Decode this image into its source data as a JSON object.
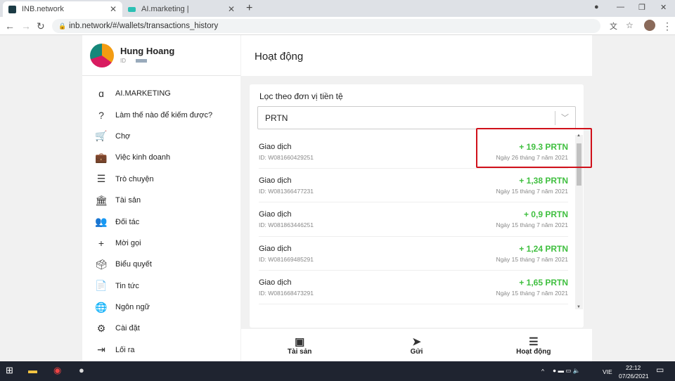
{
  "browser": {
    "tabs": [
      {
        "title": "INB.network"
      },
      {
        "title": "AI.marketing |"
      }
    ],
    "url": "inb.network/#/wallets/transactions_history"
  },
  "profile": {
    "name": "Hung Hoang",
    "id_label": "ID"
  },
  "menu": [
    {
      "label": "AI.MARKETING",
      "icon": "ai-logo-icon",
      "glyph": "ɑ"
    },
    {
      "label": "Làm thế nào để kiếm được?",
      "icon": "help-icon",
      "glyph": "?"
    },
    {
      "label": "Chợ",
      "icon": "cart-icon",
      "glyph": "🛒"
    },
    {
      "label": "Việc kinh doanh",
      "icon": "briefcase-icon",
      "glyph": "💼"
    },
    {
      "label": "Trò chuyện",
      "icon": "chat-icon",
      "glyph": "☰"
    },
    {
      "label": "Tài sản",
      "icon": "bank-icon",
      "glyph": "🏛"
    },
    {
      "label": "Đối tác",
      "icon": "partners-icon",
      "glyph": "👥"
    },
    {
      "label": "Mời gọi",
      "icon": "invite-icon",
      "glyph": "+"
    },
    {
      "label": "Biểu quyết",
      "icon": "vote-icon",
      "glyph": "🗳"
    },
    {
      "label": "Tin tức",
      "icon": "news-icon",
      "glyph": "📄"
    },
    {
      "label": "Ngôn ngữ",
      "icon": "globe-icon",
      "glyph": "🌐"
    },
    {
      "label": "Cài đặt",
      "icon": "gear-icon",
      "glyph": "⚙"
    },
    {
      "label": "Lối ra",
      "icon": "logout-icon",
      "glyph": "⇥"
    }
  ],
  "main": {
    "title": "Hoạt động",
    "filter_label": "Lọc theo đơn vị tiền tệ",
    "currency": "PRTN"
  },
  "transactions": [
    {
      "type": "Giao dịch",
      "id": "ID: W081660429251",
      "amount": "+ 19.3 PRTN",
      "date": "Ngày 26 tháng 7 năm 2021"
    },
    {
      "type": "Giao dịch",
      "id": "ID: W081366477231",
      "amount": "+ 1,38 PRTN",
      "date": "Ngày 15 tháng 7 năm 2021"
    },
    {
      "type": "Giao dịch",
      "id": "ID: W081863446251",
      "amount": "+ 0,9 PRTN",
      "date": "Ngày 15 tháng 7 năm 2021"
    },
    {
      "type": "Giao dịch",
      "id": "ID: W081669485291",
      "amount": "+ 1,24 PRTN",
      "date": "Ngày 15 tháng 7 năm 2021"
    },
    {
      "type": "Giao dịch",
      "id": "ID: W081668473291",
      "amount": "+ 1,65 PRTN",
      "date": "Ngày 15 tháng 7 năm 2021"
    }
  ],
  "bottom_nav": [
    {
      "label": "Tài sản"
    },
    {
      "label": "Gửi"
    },
    {
      "label": "Hoạt động"
    }
  ],
  "taskbar": {
    "lang": "VIE",
    "time": "22:12",
    "date": "07/26/2021"
  },
  "colors": {
    "positive": "#3fbf3f",
    "highlight": "#d0101a"
  }
}
